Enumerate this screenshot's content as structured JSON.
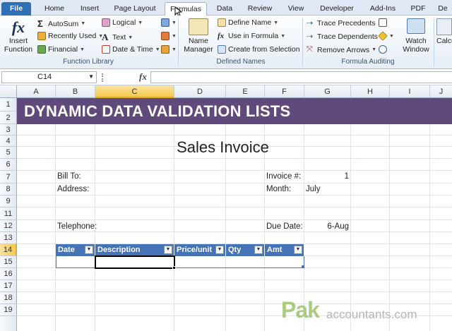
{
  "tabs": [
    "File",
    "Home",
    "Insert",
    "Page Layout",
    "Formulas",
    "Data",
    "Review",
    "View",
    "Developer",
    "Add-Ins",
    "PDF",
    "De"
  ],
  "ribbon": {
    "insert_function": {
      "line1": "Insert",
      "line2": "Function"
    },
    "autosum": "AutoSum",
    "recently_used": "Recently Used",
    "financial": "Financial",
    "logical": "Logical",
    "text": "Text",
    "date_time": "Date & Time",
    "function_library": "Function Library",
    "name_manager": {
      "line1": "Name",
      "line2": "Manager"
    },
    "define_name": "Define Name",
    "use_in_formula": "Use in Formula",
    "create_from_selection": "Create from Selection",
    "defined_names": "Defined Names",
    "trace_precedents": "Trace Precedents",
    "trace_dependents": "Trace Dependents",
    "remove_arrows": "Remove Arrows",
    "watch_window": {
      "line1": "Watch",
      "line2": "Window"
    },
    "formula_auditing": "Formula Auditing",
    "calc": "Calcu"
  },
  "formula_bar": {
    "name_box": "C14",
    "fx": "fx",
    "formula": ""
  },
  "columns": [
    "A",
    "B",
    "C",
    "D",
    "E",
    "F",
    "G",
    "H",
    "I",
    "J"
  ],
  "rows": [
    "1",
    "2",
    "3",
    "4",
    "5",
    "6",
    "7",
    "8",
    "9",
    "11",
    "12",
    "13",
    "14",
    "15",
    "16",
    "17",
    "18",
    "19"
  ],
  "sheet": {
    "banner": "DYNAMIC DATA VALIDATION LISTS",
    "invoice_title": "Sales Invoice",
    "bill_to": "Bill To:",
    "address": "Address:",
    "telephone": "Telephone:",
    "invoice_no_label": "Invoice #:",
    "invoice_no_value": "1",
    "month_label": "Month:",
    "month_value": "July",
    "due_date_label": "Due Date:",
    "due_date_value": "6-Aug",
    "table_headers": [
      "Date",
      "Description",
      "Price/unit",
      "Qty",
      "Amt"
    ]
  },
  "watermark": {
    "pak": "Pak",
    "rest": "accountants.com"
  },
  "colors": {
    "banner": "#604a7b",
    "table_header": "#4474b5",
    "active_col": "#f5c94e",
    "file_tab": "#2f6fb5"
  }
}
